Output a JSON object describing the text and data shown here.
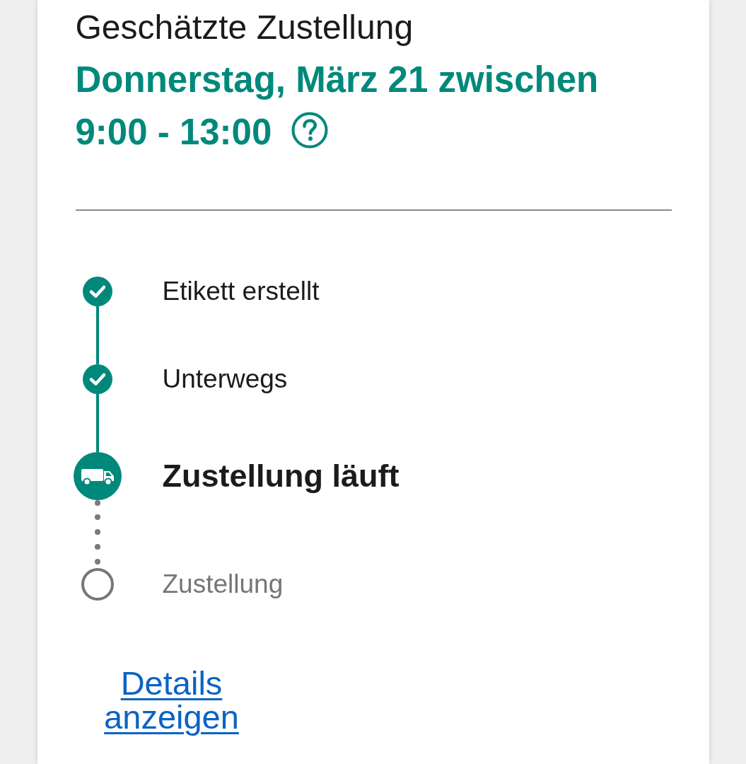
{
  "estimate": {
    "label": "Geschätzte Zustellung",
    "window_date": "Donnerstag, März 21 zwischen",
    "window_time": "9:00 - 13:00"
  },
  "steps": [
    {
      "label": "Etikett erstellt",
      "kind": "done"
    },
    {
      "label": "Unterwegs",
      "kind": "done"
    },
    {
      "label": "Zustellung läuft",
      "kind": "current"
    },
    {
      "label": "Zustellung",
      "kind": "pending"
    }
  ],
  "details_link": "Details anzeigen"
}
